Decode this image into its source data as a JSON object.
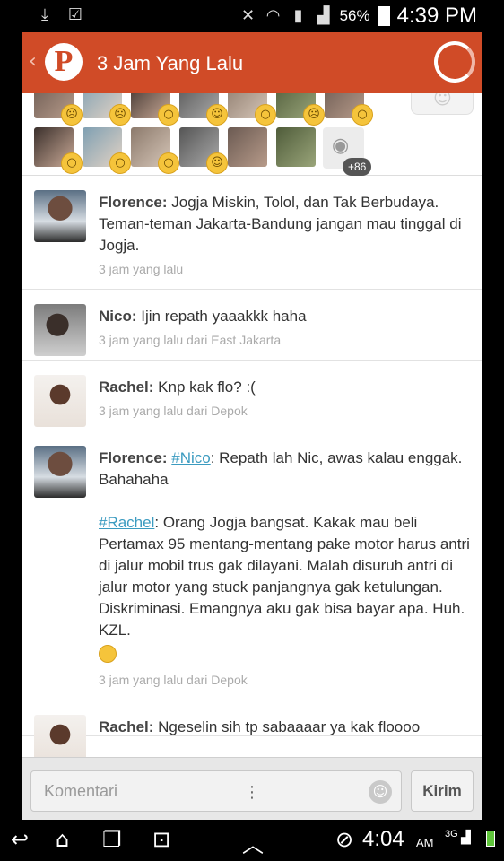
{
  "status_bar": {
    "battery_pct": "56%",
    "time": "4:39 PM",
    "icons": [
      "download-icon",
      "bag-icon",
      "mute-icon",
      "wifi-icon",
      "sim-icon",
      "signal-icon",
      "battery-icon"
    ]
  },
  "app_bar": {
    "logo_letter": "P",
    "title": "3 Jam Yang Lalu"
  },
  "reactions": {
    "more_count": "+86"
  },
  "comments": [
    {
      "author": "Florence:",
      "text": "Jogja Miskin, Tolol, dan Tak Berbudaya. Teman-teman Jakarta-Bandung jangan mau tinggal di Jogja.",
      "meta": "3 jam yang lalu"
    },
    {
      "author": "Nico:",
      "text": "Ijin repath yaaakkk haha",
      "meta": "3 jam yang lalu dari East Jakarta"
    },
    {
      "author": "Rachel:",
      "text": "Knp kak flo? :(",
      "meta": "3 jam yang lalu dari Depok"
    },
    {
      "author": "Florence:",
      "mention1": "#Nico",
      "text1": ": Repath lah Nic, awas kalau enggak. Bahahaha",
      "mention2": "#Rachel",
      "text2": ": Orang Jogja bangsat. Kakak mau beli Pertamax 95 mentang-mentang pake motor harus antri di jalur mobil trus gak dilayani. Malah disuruh antri di jalur motor yang stuck panjangnya gak ketulungan. Diskriminasi. Emangnya aku gak bisa bayar apa. Huh. KZL.",
      "meta": "3 jam yang lalu dari Depok"
    },
    {
      "author": "Rachel:",
      "text": "Ngeselin sih tp sabaaaar ya kak floooo"
    }
  ],
  "composer": {
    "placeholder": "Komentari",
    "send_label": "Kirim"
  },
  "nav_bar": {
    "time": "4:04",
    "ampm": "AM",
    "network": "3G"
  }
}
